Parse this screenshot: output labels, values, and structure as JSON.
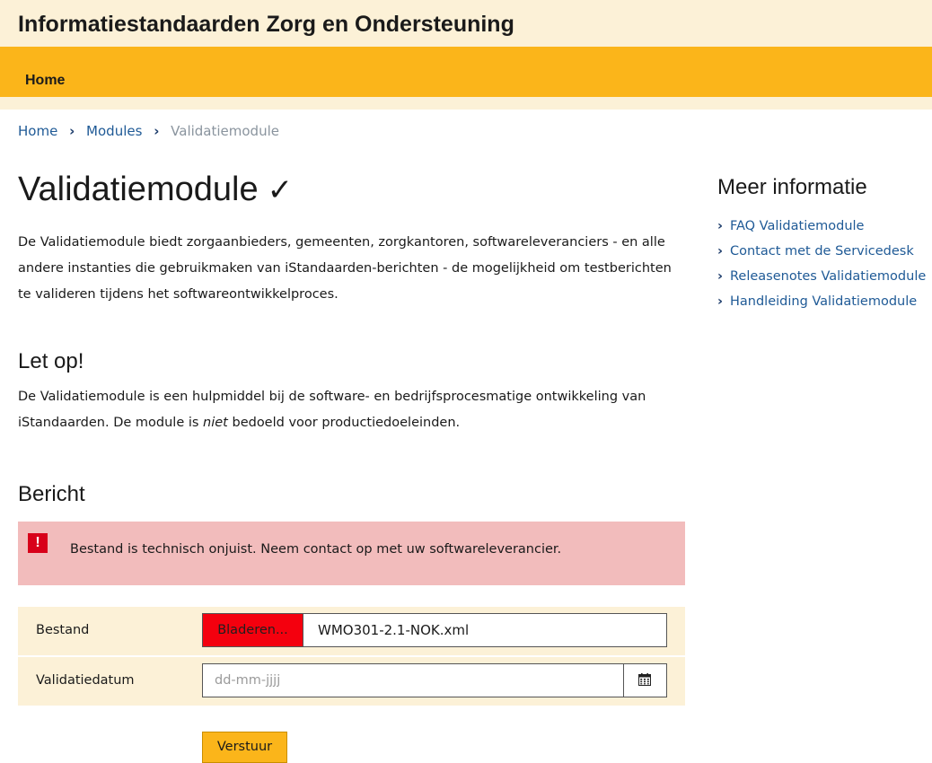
{
  "header": {
    "site_title": "Informatiestandaarden Zorg en Ondersteuning"
  },
  "nav": {
    "items": [
      {
        "label": "Home"
      }
    ]
  },
  "breadcrumb": {
    "items": [
      {
        "label": "Home"
      },
      {
        "label": "Modules"
      }
    ],
    "current": "Validatiemodule",
    "separator": "›"
  },
  "main": {
    "title": "Validatiemodule",
    "title_mark": "✓",
    "intro": "De Validatiemodule biedt zorgaanbieders, gemeenten, zorgkantoren, softwareleveranciers - en alle andere instanties die gebruikmaken van iStandaarden-berichten - de mogelijkheid om testberichten te valideren tijdens het softwareontwikkelproces.",
    "warning_heading": "Let op!",
    "warning_text_before": "De Validatiemodule is een hulpmiddel bij de software- en bedrijfsprocesmatige ontwikkeling van iStandaarden. De module is ",
    "warning_text_emph": "niet",
    "warning_text_after": " bedoeld voor productiedoeleinden.",
    "form_heading": "Bericht"
  },
  "alert": {
    "icon": "!",
    "icon_name": "exclamation-icon",
    "message": "Bestand is technisch onjuist. Neem contact op met uw softwareleverancier.",
    "color": "#f2bcbc"
  },
  "form": {
    "file_label": "Bestand",
    "browse_label": "Bladeren...",
    "file_name": "WMO301-2.1-NOK.xml",
    "date_label": "Validatiedatum",
    "date_value": "",
    "date_placeholder": "dd-mm-jjjj",
    "submit_label": "Verstuur"
  },
  "sidebar": {
    "title": "Meer informatie",
    "links": [
      {
        "label": "FAQ Validatiemodule"
      },
      {
        "label": "Contact met de Servicedesk"
      },
      {
        "label": "Releasenotes Validatiemodule"
      },
      {
        "label": "Handleiding Validatiemodule"
      }
    ]
  },
  "colors": {
    "accent": "#fbb51a",
    "header_bg": "#fcf1d7",
    "link": "#1f5a96",
    "error": "#d8001a",
    "browse_button": "#f4000e"
  }
}
